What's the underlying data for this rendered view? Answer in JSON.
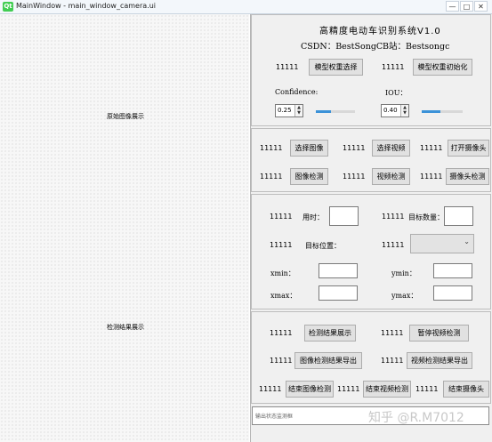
{
  "window": {
    "title": "MainWindow - main_window_camera.ui",
    "app_icon": "Qt",
    "min": "—",
    "max": "□",
    "close": "✕"
  },
  "left": {
    "original_label": "原始图像展示",
    "result_label": "检测结果展示"
  },
  "header": {
    "title": "高精度电动车识别系统V1.0",
    "csdn_label": "CSDN：BestSongC",
    "bzhan_label": "B站：Bestsongc"
  },
  "model": {
    "label1": "11111",
    "select_btn": "模型权重选择",
    "label2": "11111",
    "init_btn": "模型权重初始化",
    "confidence_label": "Confidence:",
    "confidence_value": "0.25",
    "iou_label": "IOU：",
    "iou_value": "0.40"
  },
  "media": {
    "l1": "11111",
    "select_image": "选择图像",
    "l2": "11111",
    "select_video": "选择视频",
    "l3": "11111",
    "open_camera": "打开摄像头",
    "l4": "11111",
    "image_detect": "图像检测",
    "l5": "11111",
    "video_detect": "视频检测",
    "l6": "11111",
    "camera_detect": "摄像头检测"
  },
  "info": {
    "l1": "11111",
    "time_label": "用时：",
    "l2": "11111",
    "count_label": "目标数量：",
    "l3": "11111",
    "pos_label": "目标位置：",
    "l4": "11111",
    "xmin_label": "xmin：",
    "ymin_label": "ymin：",
    "xmax_label": "xmax：",
    "ymax_label": "ymax："
  },
  "results": {
    "l1": "11111",
    "show_btn": "检测结果展示",
    "l2": "11111",
    "pause_btn": "暂停视频检测",
    "l3": "11111",
    "export_img_btn": "图像检测结果导出",
    "l4": "11111",
    "export_vid_btn": "视频检测结果导出",
    "l5": "11111",
    "end_img_btn": "结束图像检测",
    "l6": "11111",
    "end_vid_btn": "结束视频检测",
    "l7": "11111",
    "end_cam_btn": "结束摄像头"
  },
  "status": {
    "placeholder": "输出状态监测框"
  },
  "watermark": "知乎 @R.M7012"
}
